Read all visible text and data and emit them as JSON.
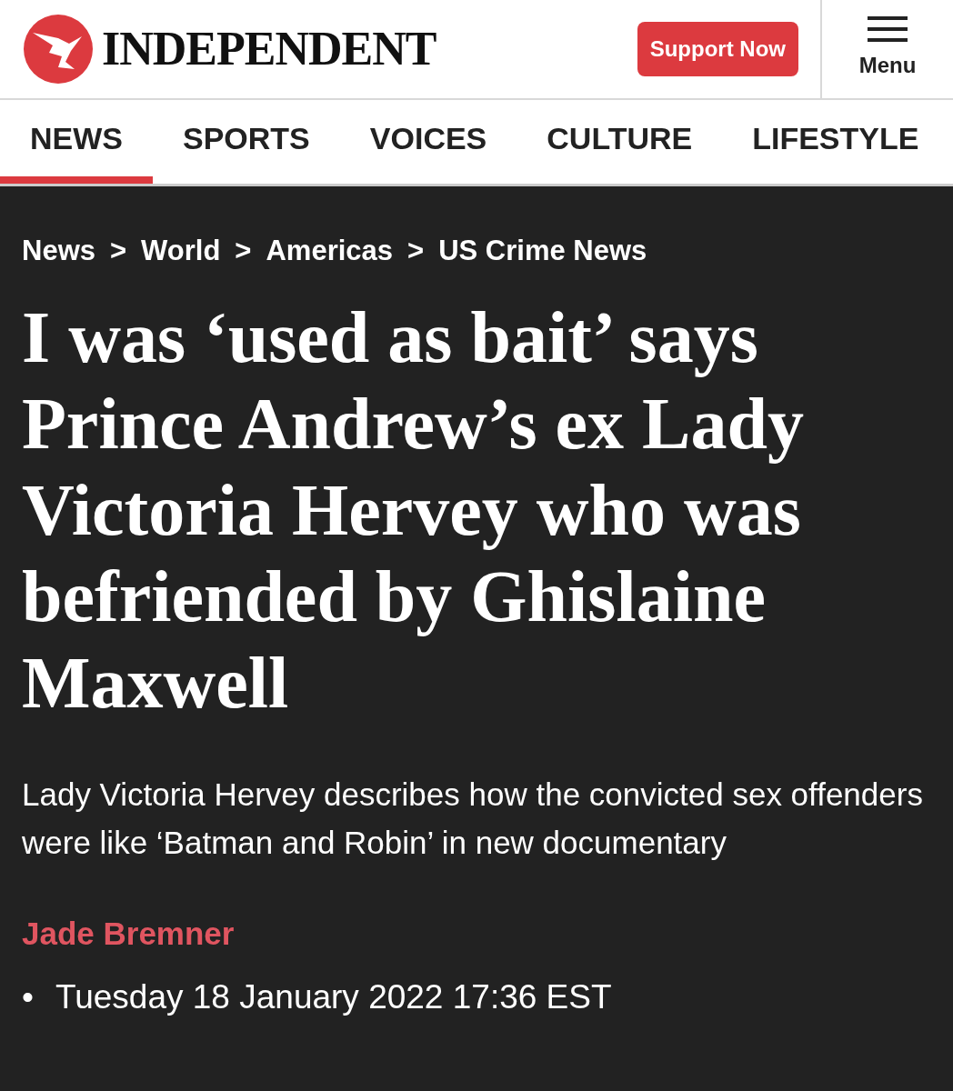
{
  "header": {
    "logo_text": "INDEPENDENT",
    "support_button": "Support Now",
    "menu_label": "Menu"
  },
  "nav": [
    {
      "label": "NEWS",
      "selected": true
    },
    {
      "label": "SPORTS",
      "selected": false
    },
    {
      "label": "VOICES",
      "selected": false
    },
    {
      "label": "CULTURE",
      "selected": false
    },
    {
      "label": "LIFESTYLE",
      "selected": false
    }
  ],
  "breadcrumb": {
    "items": [
      "News",
      "World",
      "Americas",
      "US Crime News"
    ],
    "separator": ">"
  },
  "article": {
    "headline": "I was ‘used as bait’ says Prince Andrew’s ex Lady Victoria Hervey who was befriended by Ghislaine Maxwell",
    "standfirst": "Lady Victoria Hervey describes how the convicted sex offenders were like ‘Batman and Robin’ in new documentary",
    "author": "Jade Bremner",
    "date_bullet": "•",
    "date": "Tuesday 18 January 2022 17:36 EST"
  }
}
